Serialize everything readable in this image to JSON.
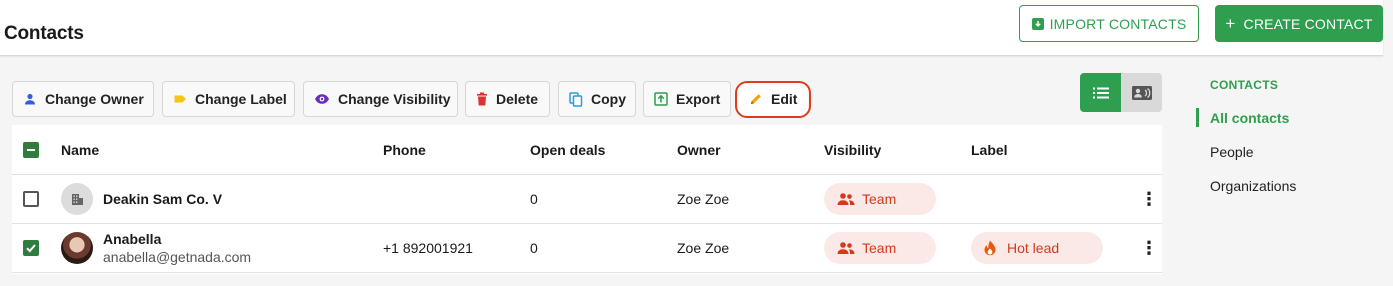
{
  "header": {
    "title": "Contacts",
    "import_label": "IMPORT CONTACTS",
    "create_label": "CREATE CONTACT"
  },
  "toolbar": {
    "change_owner": "Change Owner",
    "change_label": "Change Label",
    "change_visibility": "Change Visibility",
    "delete": "Delete",
    "copy": "Copy",
    "export": "Export",
    "edit": "Edit"
  },
  "table": {
    "columns": [
      "Name",
      "Phone",
      "Open deals",
      "Owner",
      "Visibility",
      "Label"
    ],
    "rows": [
      {
        "name": "Deakin Sam Co. V",
        "email": "",
        "phone": "",
        "open_deals": "0",
        "owner": "Zoe Zoe",
        "visibility": "Team",
        "label": "",
        "checked": false
      },
      {
        "name": "Anabella",
        "email": "anabella@getnada.com",
        "phone": "+1 892001921",
        "open_deals": "0",
        "owner": "Zoe Zoe",
        "visibility": "Team",
        "label": "Hot lead",
        "checked": true
      }
    ]
  },
  "sidebar": {
    "heading": "CONTACTS",
    "items": [
      {
        "label": "All contacts",
        "active": true
      },
      {
        "label": "People",
        "active": false
      },
      {
        "label": "Organizations",
        "active": false
      }
    ]
  },
  "colors": {
    "accent": "#2e9e4f",
    "danger": "#d13a1a",
    "highlight": "#e23b1c"
  },
  "icons": {
    "change_owner": "person-icon",
    "change_label": "label-tag-icon",
    "change_visibility": "eye-icon",
    "delete": "trash-icon",
    "copy": "copy-icon",
    "export": "export-icon",
    "edit": "pencil-icon",
    "list_view": "list-view-icon",
    "card_view": "contact-card-icon",
    "team": "team-icon",
    "hot_lead": "fire-icon"
  }
}
